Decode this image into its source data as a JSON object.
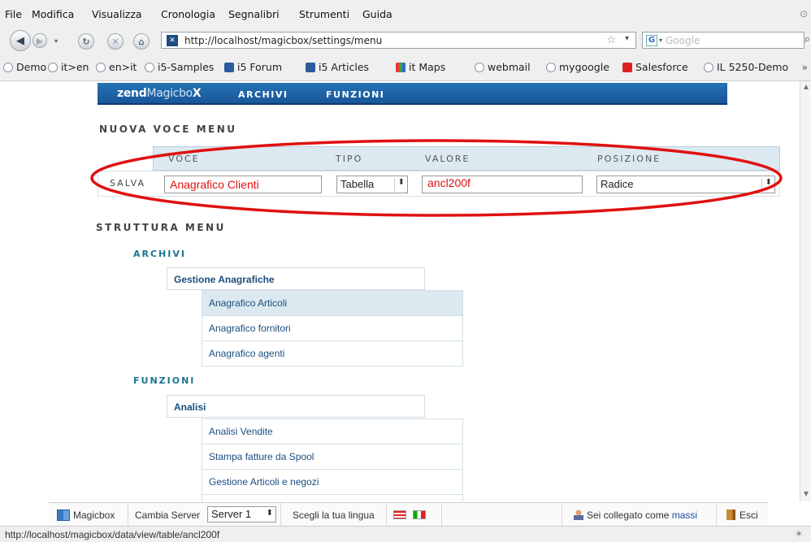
{
  "browser": {
    "menu": [
      "File",
      "Modifica",
      "Visualizza",
      "Cronologia",
      "Segnalibri",
      "Strumenti",
      "Guida"
    ],
    "url": "http://localhost/magicbox/settings/menu",
    "search_placeholder": "Google",
    "bookmarks": [
      "Demo",
      "it>en",
      "en>it",
      "i5-Samples",
      "i5 Forum",
      "i5 Articles",
      "it Maps",
      "webmail",
      "mygoogle",
      "Salesforce",
      "IL 5250-Demo"
    ],
    "bookmarks_more": "»"
  },
  "app": {
    "logo_zend": "zend",
    "logo_magicbo": "Magicbo",
    "logo_x": "X",
    "nav": [
      "ARCHIVI",
      "FUNZIONI"
    ]
  },
  "form": {
    "title": "NUOVA VOCE MENU",
    "headers": {
      "voce": "VOCE",
      "tipo": "TIPO",
      "valore": "VALORE",
      "posizione": "POSIZIONE"
    },
    "save_label": "SALVA",
    "voce_value": "Anagrafico Clienti",
    "tipo_value": "Tabella",
    "valore_value": "ancl200f",
    "posizione_value": "Radice"
  },
  "structure": {
    "title": "STRUTTURA MENU",
    "archivi_label": "ARCHIVI",
    "archivi_parent": "Gestione Anagrafiche",
    "archivi_items": [
      "Anagrafico Articoli",
      "Anagrafico fornitori",
      "Anagrafico agenti"
    ],
    "funzioni_label": "FUNZIONI",
    "funzioni_parent": "Analisi",
    "funzioni_items": [
      "Analisi Vendite",
      "Stampa fatture da Spool",
      "Gestione Articoli e negozi"
    ]
  },
  "footer": {
    "app_name": "Magicbox",
    "change_server": "Cambia Server",
    "server_value": "Server 1",
    "choose_language": "Scegli la tua lingua",
    "logged_in_as": "Sei collegato come",
    "username": "massi",
    "logout": "Esci"
  },
  "status": {
    "url": "http://localhost/magicbox/data/view/table/ancl200f"
  },
  "colors": {
    "header_blue": "#1e64a6",
    "accent_teal": "#1b7590",
    "highlight_row": "#dce9f1",
    "annotation_red": "#e01010"
  }
}
